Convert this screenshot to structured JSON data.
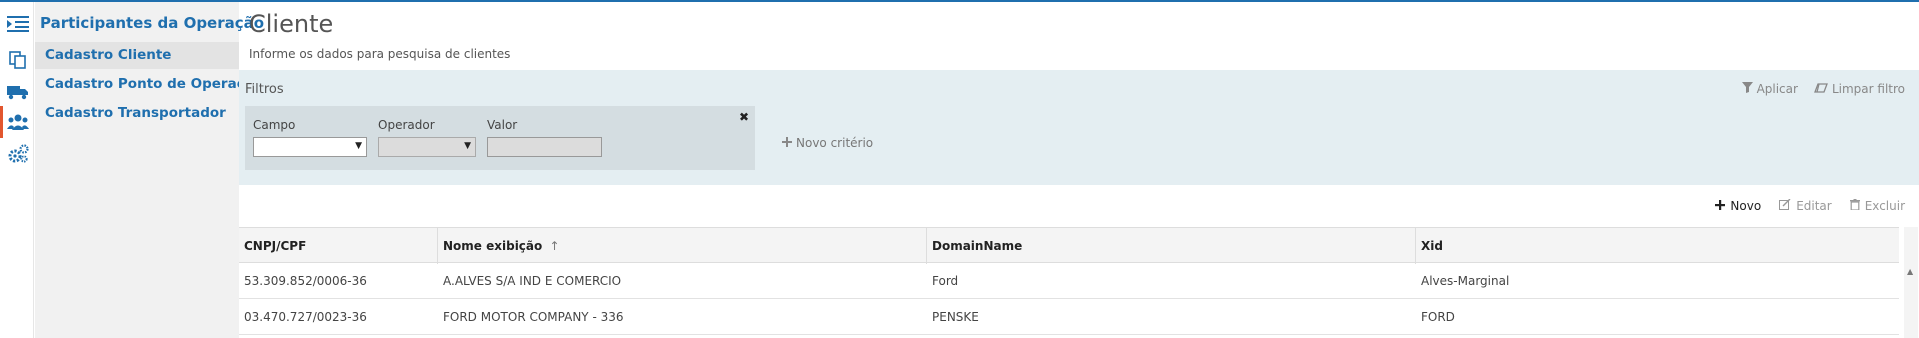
{
  "rail": {
    "icons": [
      "menu-toggle-icon",
      "documents-icon",
      "truck-icon",
      "users-icon",
      "settings-icon"
    ]
  },
  "subnav": {
    "title": "Participantes da Operação",
    "items": [
      {
        "label": "Cadastro Cliente",
        "active": true
      },
      {
        "label": "Cadastro Ponto de Operação",
        "active": false
      },
      {
        "label": "Cadastro Transportador",
        "active": false
      }
    ]
  },
  "page": {
    "title": "Cliente",
    "subtitle": "Informe os dados para pesquisa de clientes"
  },
  "filters": {
    "title": "Filtros",
    "apply_label": "Aplicar",
    "clear_label": "Limpar filtro",
    "criteria": {
      "field_label": "Campo",
      "field_value": "",
      "operator_label": "Operador",
      "operator_value": "",
      "value_label": "Valor",
      "value_value": "",
      "close_glyph": "✖"
    },
    "new_criterion_label": "Novo critério"
  },
  "toolbar": {
    "new_label": "Novo",
    "edit_label": "Editar",
    "delete_label": "Excluir"
  },
  "table": {
    "columns": [
      "CNPJ/CPF",
      "Nome exibição",
      "DomainName",
      "Xid"
    ],
    "sort_indicator": "↑",
    "rows": [
      [
        "53.309.852/0006-36",
        "A.ALVES S/A IND E COMERCIO",
        "Ford",
        "Alves-Marginal"
      ],
      [
        "03.470.727/0023-36",
        "FORD MOTOR COMPANY - 336",
        "PENSKE",
        "FORD"
      ]
    ]
  },
  "colors": {
    "accent": "#1f6fae",
    "active_marker": "#e2562e",
    "filters_bg": "#e4eef2",
    "criteria_bg": "#d4dde1"
  }
}
